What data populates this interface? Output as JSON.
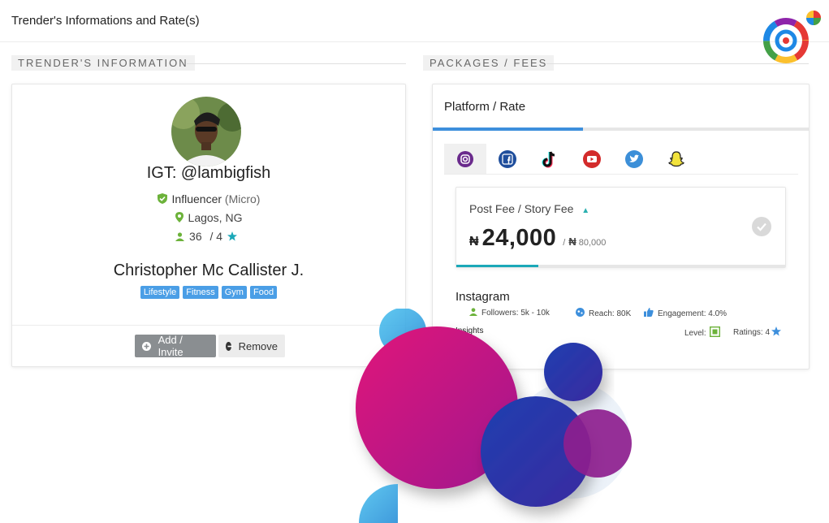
{
  "header": {
    "title": "Trender's Informations and Rate(s)"
  },
  "sections": {
    "info_label": "TRENDER'S INFORMATION",
    "packages_label": "PACKAGES / FEES"
  },
  "profile": {
    "handle": "IGT: @lambigfish",
    "category": "Influencer",
    "category_type": "(Micro)",
    "location": "Lagos, NG",
    "count": "36",
    "rating": "/ 4",
    "full_name": "Christopher Mc Callister J.",
    "tags": [
      "Lifestyle",
      "Fitness",
      "Gym",
      "Food"
    ]
  },
  "actions": {
    "add_label": "Add / Invite",
    "remove_label": "Remove"
  },
  "packages": {
    "title": "Platform / Rate",
    "tab_progress": 0.4,
    "platforms": [
      {
        "name": "instagram-icon",
        "color": "#6a2a8c"
      },
      {
        "name": "facebook-icon",
        "color": "#1f4e9c"
      },
      {
        "name": "tiktok-icon",
        "color": "#111111"
      },
      {
        "name": "youtube-icon",
        "color": "#d32b2b"
      },
      {
        "name": "twitter-icon",
        "color": "#3c8fd8"
      },
      {
        "name": "snapchat-icon",
        "color": "#f2e33c"
      }
    ],
    "fee": {
      "label": "Post Fee / Story Fee",
      "currency": "₦",
      "post_fee": "24,000",
      "separator": "/",
      "story_fee": "80,000",
      "progress": 0.25
    },
    "platform_detail": {
      "name": "Instagram",
      "followers": "Followers: 5k - 10k",
      "reach": "Reach: 80K",
      "engagement": "Engagement: 4.0%",
      "insights": "Insights",
      "level": "Level:",
      "ratings": "Ratings: 4"
    }
  },
  "colors": {
    "accent_blue": "#3d8fdc",
    "tag_blue": "#4a9ee6",
    "teal": "#1ba8b8",
    "green": "#6cb23a"
  }
}
